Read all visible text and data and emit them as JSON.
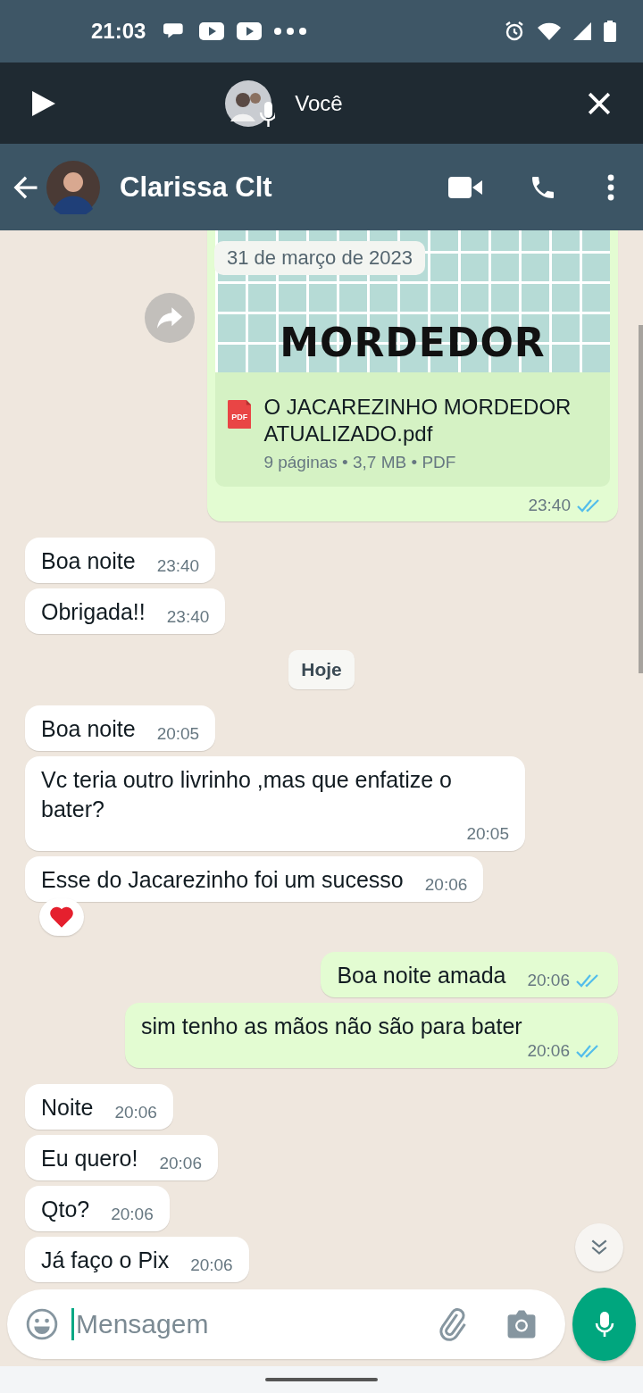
{
  "status_bar": {
    "time": "21:03"
  },
  "voice_bar": {
    "label": "Você"
  },
  "header": {
    "contact_name": "Clarissa Clt"
  },
  "sticky_date": "31 de março de 2023",
  "messages": [
    {
      "kind": "document",
      "preview_title": "MORDEDOR",
      "file_badge": "PDF",
      "file_name": "O JACAREZINHO MORDEDOR ATUALIZADO.pdf",
      "file_meta": "9 páginas • 3,7 MB • PDF",
      "time": "23:40",
      "read": true
    },
    {
      "kind": "incoming",
      "text": "Boa noite",
      "time": "23:40",
      "reacted": false
    },
    {
      "kind": "incoming",
      "text": "Obrigada!!",
      "time": "23:40",
      "reacted": false
    },
    {
      "kind": "day",
      "text": "Hoje"
    },
    {
      "kind": "incoming",
      "text": "Boa noite",
      "time": "20:05",
      "reacted": false
    },
    {
      "kind": "incoming",
      "text": "Vc teria outro livrinho ,mas que enfatize o bater?",
      "time": "20:05",
      "reacted": false
    },
    {
      "kind": "incoming",
      "text": "Esse do Jacarezinho foi um sucesso",
      "time": "20:06",
      "reacted": true
    },
    {
      "kind": "outgoing",
      "text": "Boa noite amada",
      "time": "20:06",
      "read": true
    },
    {
      "kind": "outgoing",
      "text": "sim tenho as mãos não são para bater",
      "time": "20:06",
      "read": true
    },
    {
      "kind": "incoming",
      "text": "Noite",
      "time": "20:06",
      "reacted": false
    },
    {
      "kind": "incoming",
      "text": "Eu quero!",
      "time": "20:06",
      "reacted": false
    },
    {
      "kind": "incoming",
      "text": "Qto?",
      "time": "20:06",
      "reacted": false
    },
    {
      "kind": "incoming",
      "text": "Já faço o Pix",
      "time": "20:06",
      "reacted": false
    }
  ],
  "composer": {
    "placeholder": "Mensagem"
  }
}
